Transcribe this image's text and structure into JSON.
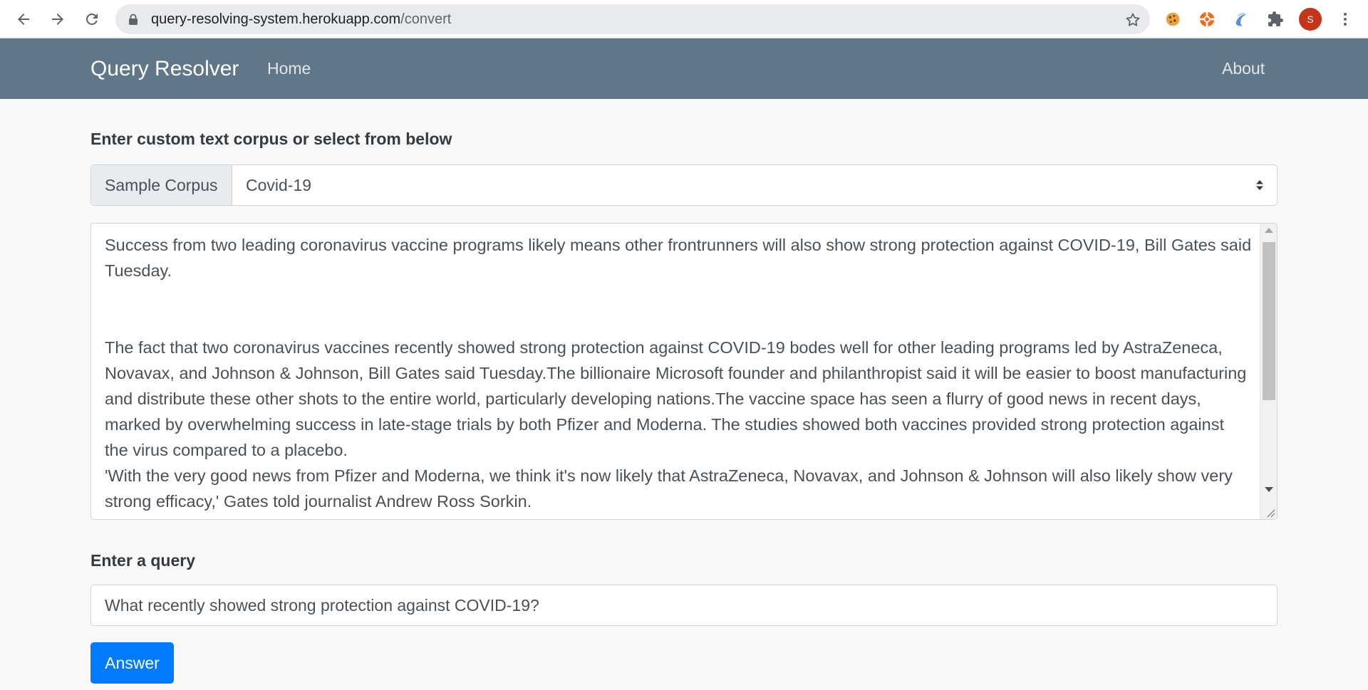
{
  "browser": {
    "url_host": "query-resolving-system.herokuapp.com",
    "url_path": "/convert",
    "profile_initial": "S",
    "icons": [
      "back-arrow-icon",
      "forward-arrow-icon",
      "reload-icon",
      "lock-icon",
      "star-icon",
      "cookie-extension-icon",
      "lifebuoy-extension-icon",
      "swirl-extension-icon",
      "puzzle-extensions-icon",
      "kebab-menu-icon"
    ]
  },
  "navbar": {
    "brand": "Query Resolver",
    "home": "Home",
    "about": "About",
    "color": "#607789"
  },
  "corpus": {
    "heading": "Enter custom text corpus or select from below",
    "addon_label": "Sample Corpus",
    "selected": "Covid-19",
    "paragraphs": [
      "Success from two leading coronavirus vaccine programs likely means other frontrunners will also show strong protection against COVID-19, Bill Gates said Tuesday.",
      "The fact that two coronavirus vaccines recently showed strong protection against COVID-19 bodes well for other leading programs led by AstraZeneca, Novavax, and Johnson & Johnson, Bill Gates said Tuesday.The billionaire Microsoft founder and philanthropist said it will be easier to boost manufacturing and distribute these other shots to the entire world, particularly developing nations.The vaccine space has seen a flurry of good news in recent days, marked by overwhelming success in late-stage trials by both Pfizer and Moderna. The studies showed both vaccines provided strong protection against the virus compared to a placebo.",
      "'With the very good news from Pfizer and Moderna, we think it's now likely that AstraZeneca, Novavax, and Johnson & Johnson will also likely show very strong efficacy,' Gates told journalist Andrew Ross Sorkin."
    ]
  },
  "query": {
    "heading": "Enter a query",
    "value": "What recently showed strong protection against COVID-19?"
  },
  "answer_button": {
    "label": "Answer",
    "color": "#007bff"
  }
}
